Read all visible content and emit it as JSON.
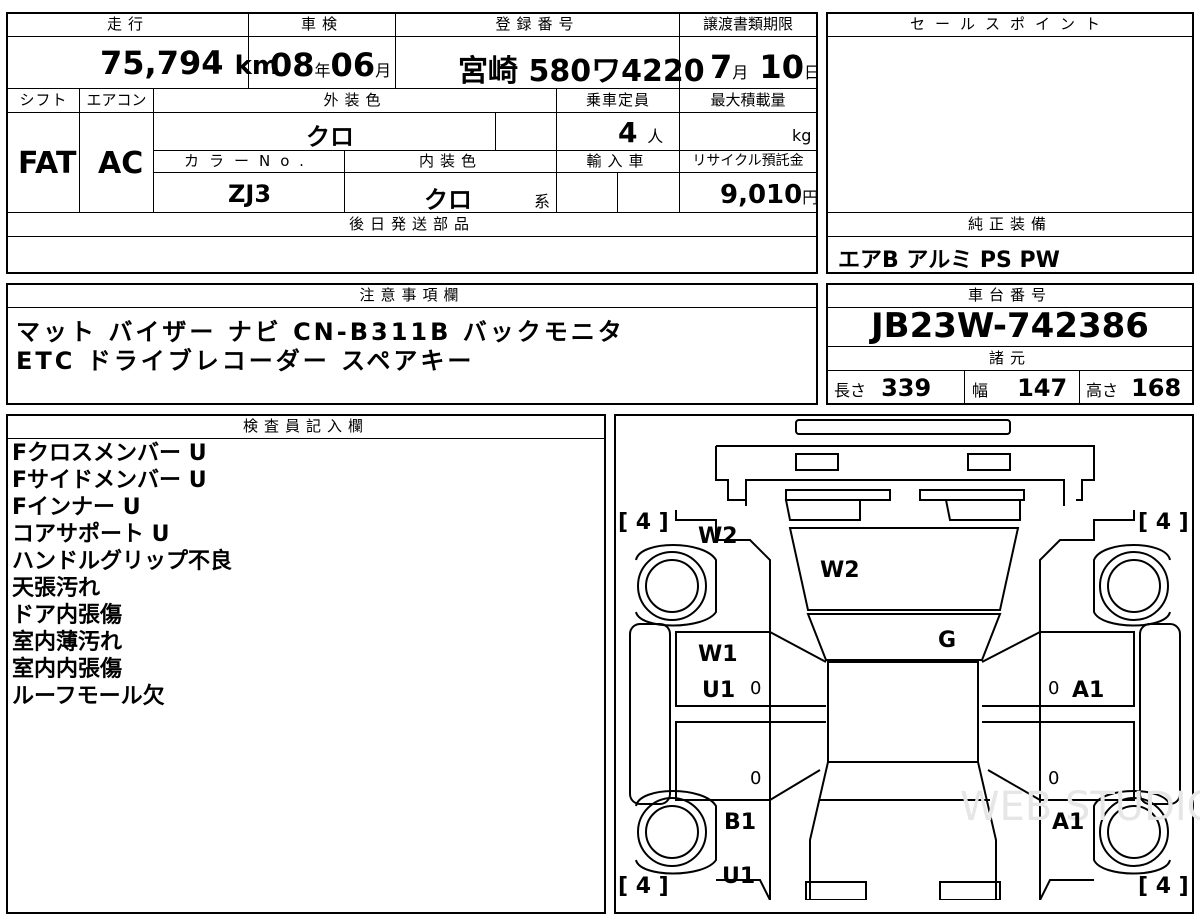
{
  "headers": {
    "mileage": "走行",
    "inspection": "車検",
    "registration": "登録番号",
    "transfer_deadline": "譲渡書類期限",
    "sales_point": "セールスポイント",
    "shift": "シフト",
    "aircon": "エアコン",
    "exterior_color": "外装色",
    "capacity": "乗車定員",
    "max_load": "最大積載量",
    "color_no": "カラーNo.",
    "interior_color": "内装色",
    "import": "輸入車",
    "recycle": "リサイクル預託金",
    "later_parts": "後日発送部品",
    "standard_equipment": "純正装備",
    "notes": "注意事項欄",
    "chassis": "車台番号",
    "specs": "諸元",
    "inspector": "検査員記入欄"
  },
  "vehicle": {
    "mileage_value": "75,794",
    "mileage_unit": "km",
    "inspection_year": "08",
    "year_unit": "年",
    "inspection_month": "06",
    "month_unit": "月",
    "registration": "宮崎 580ワ4220",
    "deadline_month": "7",
    "deadline_month_unit": "月",
    "deadline_day": "10",
    "deadline_day_unit": "日",
    "shift": "FAT",
    "aircon": "AC",
    "exterior_color": "クロ",
    "capacity": "4",
    "capacity_unit": "人",
    "max_load_unit": "kg",
    "color_no": "ZJ3",
    "interior_color": "クロ",
    "interior_suffix": "系",
    "recycle_value": "9,010",
    "recycle_unit": "円",
    "standard_equipment": "エアB アルミ PS PW",
    "chassis_number": "JB23W-742386",
    "length_label": "長さ",
    "length": "339",
    "width_label": "幅",
    "width": "147",
    "height_label": "高さ",
    "height": "168"
  },
  "notes": {
    "line1": "マット バイザー ナビ CN-B311B バックモニタ",
    "line2": "ETC ドライブレコーダー スペアキー"
  },
  "inspector_lines": [
    "Fクロスメンバー U",
    "Fサイドメンバー U",
    "Fインナー U",
    "コアサポート U",
    "ハンドルグリップ不良",
    "天張汚れ",
    "ドア内張傷",
    "室内薄汚れ",
    "室内内張傷",
    "ルーフモール欠"
  ],
  "diagram": {
    "tire_tl": "[ 4 ]",
    "tire_tr": "[ 4 ]",
    "tire_bl": "[ 4 ]",
    "tire_br": "[ 4 ]",
    "w2_front_left": "W2",
    "w2_windshield": "W2",
    "g_center": "G",
    "w1_left": "W1",
    "u1_left": "U1",
    "a1_right": "A1",
    "b1_left": "B1",
    "a1_right_rear": "A1",
    "u1_rear": "U1",
    "zero": "0",
    "watermark": "WEB STUDIO"
  }
}
